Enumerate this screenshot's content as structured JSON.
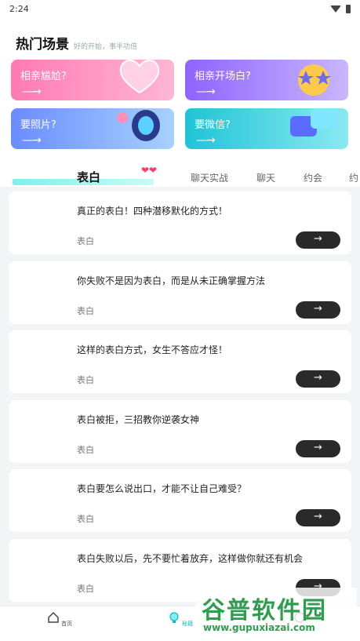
{
  "status": {
    "time": "2:24"
  },
  "section": {
    "title": "热门场景",
    "subtitle": "好的开始，事半功倍"
  },
  "cards": [
    {
      "label": "相亲尴尬?",
      "arrow": "—→"
    },
    {
      "label": "相亲开场白?",
      "arrow": "—→"
    },
    {
      "label": "要照片?",
      "arrow": "—→"
    },
    {
      "label": "要微信?",
      "arrow": "—→"
    }
  ],
  "tabs": [
    "表白",
    "聊天实战",
    "聊天",
    "约会",
    "约"
  ],
  "items": [
    {
      "title": "真正的表白！四种潜移默化的方式！",
      "tag": "表白",
      "btn": "→"
    },
    {
      "title": "你失败不是因为表白，而是从未正确掌握方法",
      "tag": "表白",
      "btn": "→"
    },
    {
      "title": "这样的表白方式，女生不答应才怪！",
      "tag": "表白",
      "btn": "→"
    },
    {
      "title": "表白被拒，三招教你逆袭女神",
      "tag": "表白",
      "btn": "→"
    },
    {
      "title": "表白要怎么说出口，才能不让自己难受？",
      "tag": "表白",
      "btn": "→"
    },
    {
      "title": "表白失败以后，先不要忙着放弃，这样做你就还有机会",
      "tag": "表白",
      "btn": "→"
    }
  ],
  "tabbar": [
    {
      "label": "首页",
      "icon": "home-icon"
    },
    {
      "label": "秘籍",
      "icon": "bulb-icon",
      "active": true
    },
    {
      "label": "",
      "icon": "user-icon"
    }
  ],
  "watermark": {
    "brand": "谷普软件园",
    "url": "www.gupuxiazai.com"
  },
  "colors": {
    "accent": "#2e9e4e",
    "tab_underline": "#7ff0ec",
    "button": "#2a2a2a"
  }
}
